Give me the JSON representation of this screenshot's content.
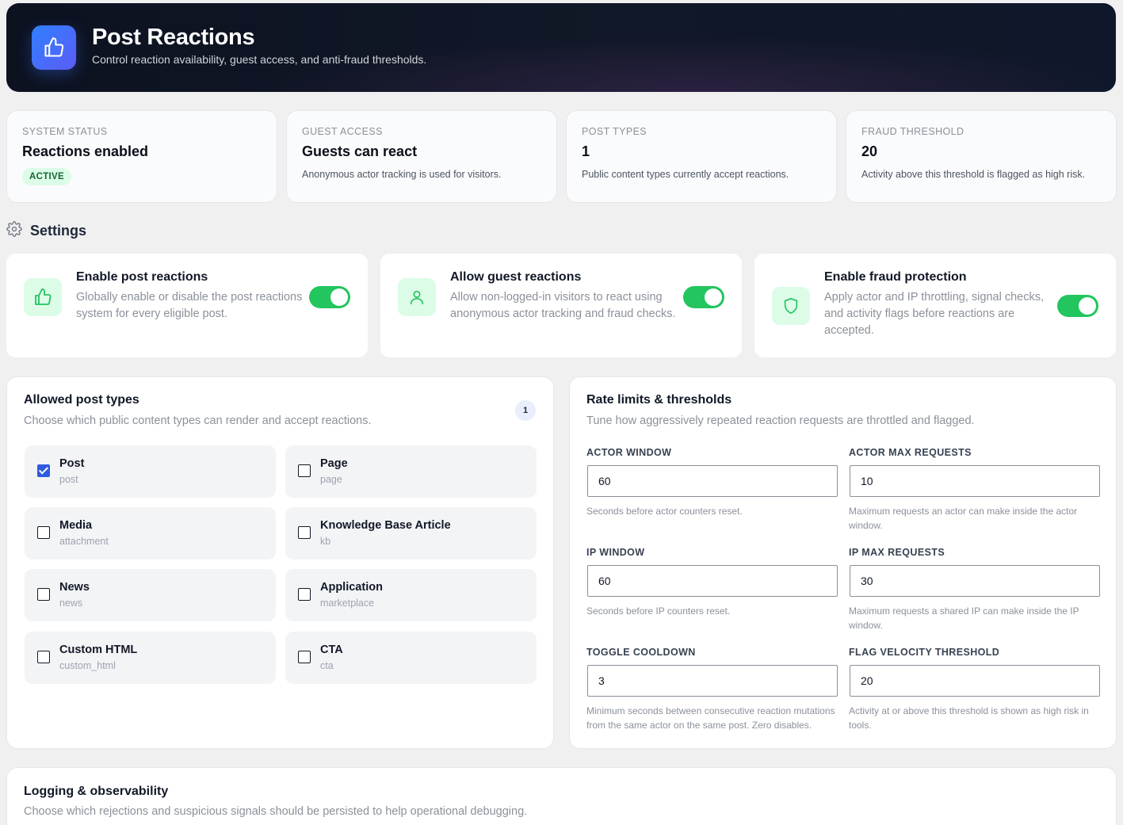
{
  "header": {
    "title": "Post Reactions",
    "subtitle": "Control reaction availability, guest access, and anti-fraud thresholds.",
    "icon": "thumbs-up-icon"
  },
  "stats": [
    {
      "label": "SYSTEM STATUS",
      "value": "Reactions enabled",
      "badge": "ACTIVE"
    },
    {
      "label": "GUEST ACCESS",
      "value": "Guests can react",
      "desc": "Anonymous actor tracking is used for visitors."
    },
    {
      "label": "POST TYPES",
      "value": "1",
      "desc": "Public content types currently accept reactions."
    },
    {
      "label": "FRAUD THRESHOLD",
      "value": "20",
      "desc": "Activity above this threshold is flagged as high risk."
    }
  ],
  "settings": {
    "title": "Settings",
    "icon": "gear-icon",
    "toggles": [
      {
        "title": "Enable post reactions",
        "desc": "Globally enable or disable the post reactions system for every eligible post.",
        "icon": "thumbs-up-icon",
        "on": true
      },
      {
        "title": "Allow guest reactions",
        "desc": "Allow non-logged-in visitors to react using anonymous actor tracking and fraud checks.",
        "icon": "user-icon",
        "on": true
      },
      {
        "title": "Enable fraud protection",
        "desc": "Apply actor and IP throttling, signal checks, and activity flags before reactions are accepted.",
        "icon": "shield-icon",
        "on": true
      }
    ]
  },
  "post_types": {
    "title": "Allowed post types",
    "desc": "Choose which public content types can render and accept reactions.",
    "count": "1",
    "items": [
      {
        "name": "Post",
        "slug": "post",
        "checked": true
      },
      {
        "name": "Page",
        "slug": "page",
        "checked": false
      },
      {
        "name": "Media",
        "slug": "attachment",
        "checked": false
      },
      {
        "name": "Knowledge Base Article",
        "slug": "kb",
        "checked": false
      },
      {
        "name": "News",
        "slug": "news",
        "checked": false
      },
      {
        "name": "Application",
        "slug": "marketplace",
        "checked": false
      },
      {
        "name": "Custom HTML",
        "slug": "custom_html",
        "checked": false
      },
      {
        "name": "CTA",
        "slug": "cta",
        "checked": false
      }
    ]
  },
  "rate_limits": {
    "title": "Rate limits & thresholds",
    "desc": "Tune how aggressively repeated reaction requests are throttled and flagged.",
    "fields": [
      {
        "label": "ACTOR WINDOW",
        "value": "60",
        "help": "Seconds before actor counters reset."
      },
      {
        "label": "ACTOR MAX REQUESTS",
        "value": "10",
        "help": "Maximum requests an actor can make inside the actor window."
      },
      {
        "label": "IP WINDOW",
        "value": "60",
        "help": "Seconds before IP counters reset."
      },
      {
        "label": "IP MAX REQUESTS",
        "value": "30",
        "help": "Maximum requests a shared IP can make inside the IP window."
      },
      {
        "label": "TOGGLE COOLDOWN",
        "value": "3",
        "help": "Minimum seconds between consecutive reaction mutations from the same actor on the same post. Zero disables."
      },
      {
        "label": "FLAG VELOCITY THRESHOLD",
        "value": "20",
        "help": "Activity at or above this threshold is shown as high risk in tools."
      }
    ]
  },
  "logging": {
    "title": "Logging & observability",
    "desc": "Choose which rejections and suspicious signals should be persisted to help operational debugging."
  },
  "colors": {
    "accent": "#22c55e",
    "brand": "#2f80ff",
    "checkbox": "#2f5be0"
  }
}
